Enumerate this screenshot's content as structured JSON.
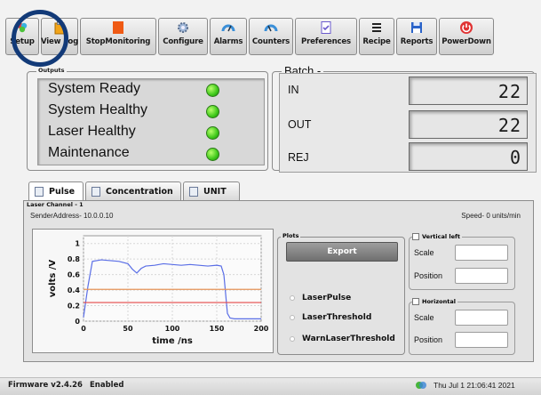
{
  "toolbar": {
    "buttons": [
      {
        "label": "Setup",
        "icon": "setup-icon"
      },
      {
        "label": "View Log",
        "icon": "clipboard-icon"
      },
      {
        "label": "StopMonitoring",
        "icon": "stop-square-icon"
      },
      {
        "label": "Configure",
        "icon": "gear-icon"
      },
      {
        "label": "Alarms",
        "icon": "gauge-icon"
      },
      {
        "label": "Counters",
        "icon": "gauge-icon"
      },
      {
        "label": "Preferences",
        "icon": "checklist-icon"
      },
      {
        "label": "Recipe",
        "icon": "list-icon"
      },
      {
        "label": "Reports",
        "icon": "floppy-icon"
      },
      {
        "label": "PowerDown",
        "icon": "power-icon"
      }
    ]
  },
  "outputs": {
    "title": "Outputs",
    "items": [
      {
        "label": "System Ready",
        "status_color": "#3ec81a"
      },
      {
        "label": "System Healthy",
        "status_color": "#3ec81a"
      },
      {
        "label": "Laser Healthy",
        "status_color": "#3ec81a"
      },
      {
        "label": "Maintenance",
        "status_color": "#3ec81a"
      }
    ]
  },
  "batch": {
    "title": "Batch -",
    "rows": [
      {
        "label": "IN",
        "value": "22"
      },
      {
        "label": "OUT",
        "value": "22"
      },
      {
        "label": "REJ",
        "value": "0"
      }
    ]
  },
  "tabs": [
    {
      "label": "Pulse",
      "active": true
    },
    {
      "label": "Concentration",
      "active": false
    },
    {
      "label": "UNIT",
      "active": false
    }
  ],
  "laser_channel": {
    "title": "Laser Channel - 1",
    "sender_address": "SenderAddress- 10.0.0.10",
    "speed": "Speed- 0 units/min"
  },
  "chart_data": {
    "type": "line",
    "xlabel": "time /ns",
    "ylabel": "volts /V",
    "xlim": [
      0,
      200
    ],
    "ylim": [
      0,
      1.1
    ],
    "xticks": [
      0,
      50,
      100,
      150,
      200
    ],
    "yticks": [
      0,
      0.2,
      0.4,
      0.6,
      0.8,
      1
    ],
    "grid": true,
    "series": [
      {
        "color": "#5a6ee6",
        "x": [
          0,
          5,
          10,
          20,
          30,
          40,
          50,
          55,
          60,
          65,
          70,
          80,
          90,
          100,
          110,
          120,
          130,
          140,
          150,
          155,
          158,
          162,
          165,
          170,
          180,
          190,
          200
        ],
        "y": [
          0.05,
          0.45,
          0.77,
          0.79,
          0.78,
          0.77,
          0.74,
          0.67,
          0.62,
          0.68,
          0.71,
          0.72,
          0.74,
          0.73,
          0.72,
          0.73,
          0.72,
          0.71,
          0.72,
          0.71,
          0.6,
          0.1,
          0.04,
          0.03,
          0.03,
          0.03,
          0.03
        ]
      },
      {
        "color": "#e6945a",
        "x": [
          0,
          200
        ],
        "y": [
          0.41,
          0.41
        ]
      },
      {
        "color": "#e64a4a",
        "x": [
          0,
          200
        ],
        "y": [
          0.24,
          0.24
        ]
      }
    ]
  },
  "plots": {
    "title": "Plots",
    "export_label": "Export",
    "options": [
      "LaserPulse",
      "LaserThreshold",
      "WarnLaserThreshold"
    ]
  },
  "vertical_left": {
    "title": "Vertical left",
    "scale_label": "Scale",
    "position_label": "Position"
  },
  "horizontal": {
    "title": "Horizontal",
    "scale_label": "Scale",
    "position_label": "Position"
  },
  "status_bar": {
    "firmware": "Firmware v2.4.26",
    "state": "Enabled",
    "datetime": "Thu Jul 1 21:06:41 2021"
  }
}
